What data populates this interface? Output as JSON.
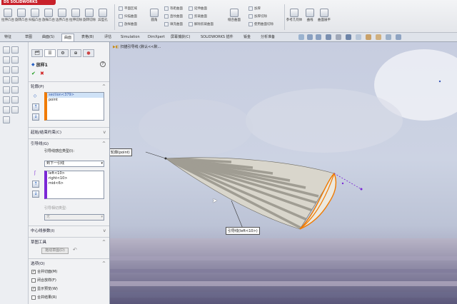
{
  "app": {
    "logo_text": "DS SOLIDWORKS"
  },
  "ribbon": {
    "big_buttons": [
      {
        "label": "拉伸凸台",
        "icon": "extrude-boss-icon"
      },
      {
        "label": "旋转凸台",
        "icon": "revolve-boss-icon"
      },
      {
        "label": "扫描凸台",
        "icon": "sweep-boss-icon"
      },
      {
        "label": "放样凸台",
        "icon": "loft-boss-icon"
      },
      {
        "label": "边界凸台",
        "icon": "boundary-boss-icon"
      },
      {
        "label": "拉伸切除",
        "icon": "extrude-cut-icon"
      },
      {
        "label": "旋转切除",
        "icon": "revolve-cut-icon"
      },
      {
        "label": "异型孔",
        "icon": "hole-wizard-icon"
      }
    ],
    "small_buttons": [
      {
        "label": "平面区域"
      },
      {
        "label": "扫描曲面"
      },
      {
        "label": "放样曲面"
      },
      {
        "label": "等距曲面"
      },
      {
        "label": "直纹曲面"
      },
      {
        "label": "填充曲面"
      },
      {
        "label": "删除面"
      },
      {
        "label": "替换面"
      },
      {
        "label": "延展曲面"
      },
      {
        "label": "延伸曲面"
      },
      {
        "label": "剪裁曲面"
      },
      {
        "label": "解除剪裁曲面"
      },
      {
        "label": "缝合曲面"
      },
      {
        "label": "加厚"
      },
      {
        "label": "加厚切除"
      },
      {
        "label": "使用曲面切除"
      }
    ],
    "mid_buttons": [
      {
        "label": "圆角"
      },
      {
        "label": "缝合曲面"
      },
      {
        "label": "参考几何体"
      },
      {
        "label": "曲线"
      },
      {
        "label": "曲面展平"
      }
    ]
  },
  "tabs": [
    {
      "label": "特征",
      "active": false
    },
    {
      "label": "草图",
      "active": false
    },
    {
      "label": "曲面(S)",
      "active": false
    },
    {
      "label": "曲面",
      "active": true
    },
    {
      "label": "表格(B)",
      "active": false
    },
    {
      "label": "评估",
      "active": false
    },
    {
      "label": "Simulation",
      "active": false
    },
    {
      "label": "DimXpert",
      "active": false
    },
    {
      "label": "屏幕捕获(C)",
      "active": false
    },
    {
      "label": "SOLIDWORKS 插件",
      "active": false
    },
    {
      "label": "钣金",
      "active": false
    },
    {
      "label": "分析准备",
      "active": false
    }
  ],
  "pm": {
    "title": "放样1",
    "help": "?",
    "ok": "✔",
    "cancel": "✖",
    "profiles_header": "轮廓(P)",
    "profiles": [
      "section<379>",
      "point"
    ],
    "start_end_header": "起始/结束约束(C)",
    "guides_header": "引导线(G)",
    "guide_influence_label": "引导线感应类型(I):",
    "guide_influence_value": "到下一引线",
    "guides": [
      "left<10>",
      "right<10>",
      "mid<6>"
    ],
    "tangent_label": "引导相切类型:",
    "tangent_value": "无",
    "centerline_header": "中心线参数(I)",
    "sketch_tools_header": "草图工具",
    "drag_sketch": "拖动草图(D)",
    "options_header": "选项(O)",
    "options": [
      {
        "label": "合并切面(M)",
        "checked": true
      },
      {
        "label": "闭合放样(F)",
        "checked": false
      },
      {
        "label": "显示预览(W)",
        "checked": true
      },
      {
        "label": "合并结果(R)",
        "checked": false
      }
    ]
  },
  "viewport": {
    "breadcrumb": "扫描引导线 (默认<<默...",
    "callout_profile": "轮廓(point)",
    "callout_guide": "引导线(left<10>)"
  },
  "colors": {
    "accent": "#f07a00",
    "selection": "#3155a8",
    "guide": "#7b28d6"
  }
}
